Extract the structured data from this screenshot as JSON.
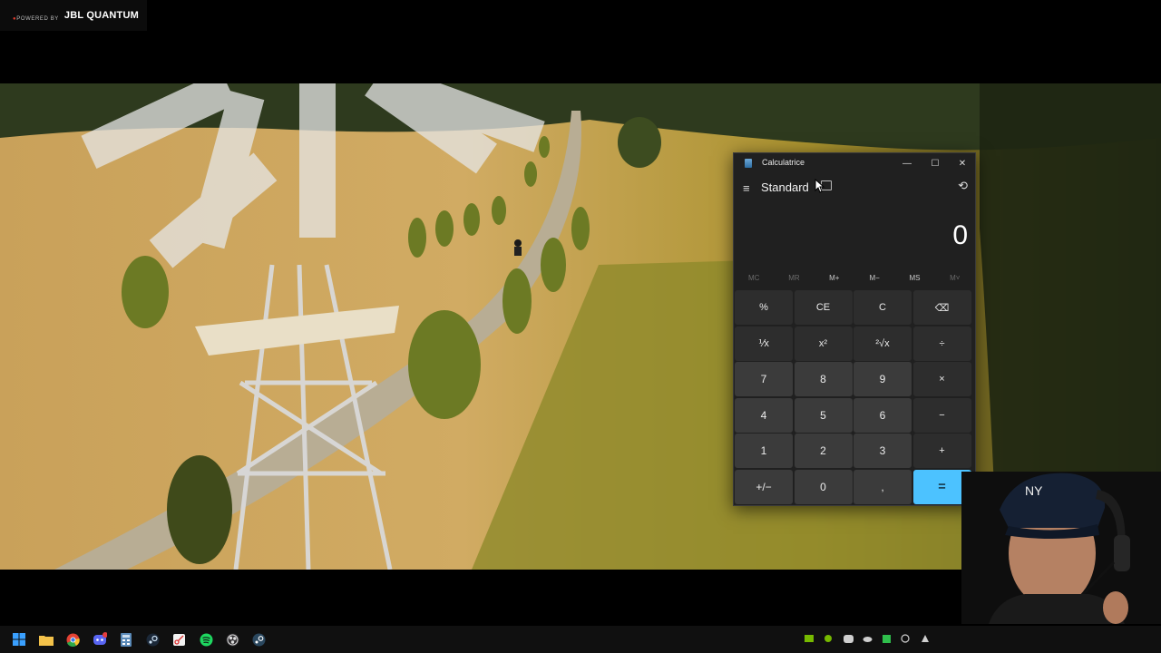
{
  "branding": {
    "powered_by": "POWERED BY",
    "brand": "JBL QUANTUM"
  },
  "calculator": {
    "window_title": "Calculatrice",
    "mode": "Standard",
    "display": "0",
    "memory": {
      "mc": "MC",
      "mr": "MR",
      "m_plus": "M+",
      "m_minus": "M−",
      "ms": "MS",
      "m_list": "M˅"
    },
    "keys": [
      [
        "%",
        "CE",
        "C",
        "⌫"
      ],
      [
        "⅟x",
        "x²",
        "²√x",
        "÷"
      ],
      [
        "7",
        "8",
        "9",
        "×"
      ],
      [
        "4",
        "5",
        "6",
        "−"
      ],
      [
        "1",
        "2",
        "3",
        "+"
      ],
      [
        "+/−",
        "0",
        ",",
        "="
      ]
    ],
    "accent_color": "#4cc2ff"
  },
  "taskbar": {
    "apps": [
      "start-icon",
      "file-explorer-icon",
      "chrome-icon",
      "discord-icon",
      "calculator-icon",
      "steam-icon",
      "snipping-icon",
      "spotify-icon",
      "obs-icon",
      "steam-alt-icon"
    ],
    "discord_badge": "9"
  }
}
